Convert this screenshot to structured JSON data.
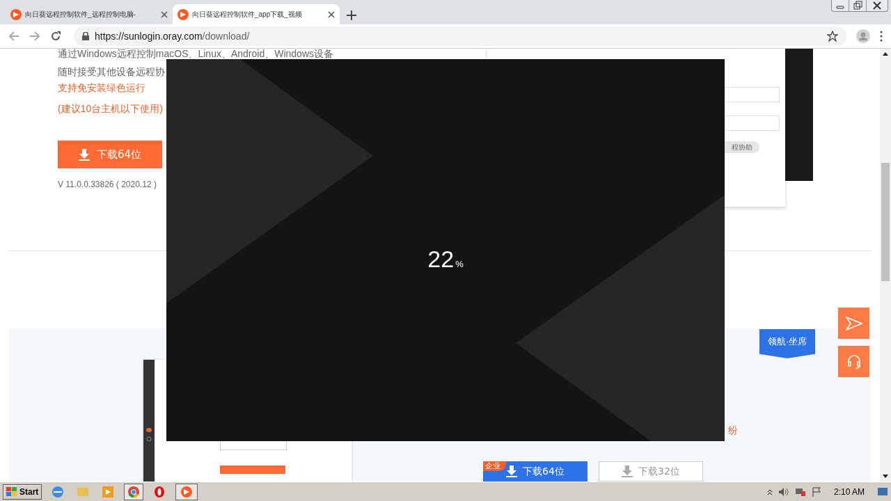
{
  "browser": {
    "tabs": [
      {
        "title": "向日葵远程控制软件_远程控制电脑-",
        "selected": false
      },
      {
        "title": "向日葵远程控制软件_app下载_视频",
        "selected": true
      }
    ],
    "url_host": "https://sunlogin.oray.com",
    "url_path": "/download/"
  },
  "page": {
    "features": [
      "通过Windows远程控制macOS、Linux、Android、Windows设备",
      "随时接受其他设备远程协"
    ],
    "highlights": [
      "支持免安装绿色运行",
      "(建议10台主机以下使用)"
    ],
    "download_button": "下载64位",
    "version": "V 11.0.0.33826 ( 2020.12 )",
    "mock_button": "程协助",
    "ribbon": "领航·坐席",
    "note": "纷",
    "enterprise_tag": "企业",
    "enterprise_buttons": [
      {
        "label": "下载64位",
        "kind": "primary"
      },
      {
        "label": "下载32位",
        "kind": "secondary"
      }
    ]
  },
  "splash": {
    "percent": "22",
    "unit": "%"
  },
  "taskbar": {
    "start": "Start",
    "clock": "2:10 AM"
  }
}
